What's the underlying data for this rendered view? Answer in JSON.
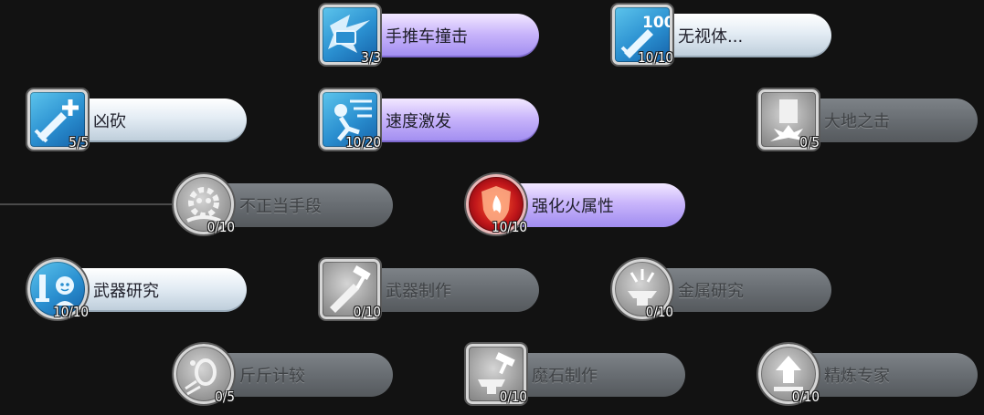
{
  "colors": {
    "background": "#121212",
    "purple_pill": "#b9a4f7",
    "light_pill": "#e3ecf4",
    "locked_pill": "#686d72",
    "icon_blue": "#2a8fd0"
  },
  "skills": [
    {
      "name": "手推车撞击",
      "level": "3/3",
      "state": "purple",
      "shape": "square",
      "icon": "cart-crash-icon"
    },
    {
      "name": "无视体...",
      "level": "10/10",
      "state": "light",
      "shape": "square",
      "icon": "sword-100-icon"
    },
    {
      "name": "凶砍",
      "level": "5/5",
      "state": "light",
      "shape": "square",
      "icon": "sword-plus-icon"
    },
    {
      "name": "速度激发",
      "level": "10/20",
      "state": "purple",
      "shape": "square",
      "icon": "speed-runner-icon"
    },
    {
      "name": "大地之击",
      "level": "0/5",
      "state": "gray",
      "shape": "square",
      "icon": "ground-strike-icon"
    },
    {
      "name": "不正当手段",
      "level": "0/10",
      "state": "gray",
      "shape": "circle",
      "icon": "trick-gear-icon"
    },
    {
      "name": "强化火属性",
      "level": "10/10",
      "state": "fire",
      "shape": "circle",
      "icon": "fire-shield-icon"
    },
    {
      "name": "武器研究",
      "level": "10/10",
      "state": "light",
      "shape": "circle",
      "icon": "weapon-study-icon"
    },
    {
      "name": "武器制作",
      "level": "0/10",
      "state": "gray",
      "shape": "square",
      "icon": "weapon-craft-icon"
    },
    {
      "name": "金属研究",
      "level": "0/10",
      "state": "gray",
      "shape": "circle",
      "icon": "metal-study-icon"
    },
    {
      "name": "斤斤计较",
      "level": "0/5",
      "state": "gray",
      "shape": "circle",
      "icon": "haggle-icon"
    },
    {
      "name": "魔石制作",
      "level": "0/10",
      "state": "gray",
      "shape": "square",
      "icon": "magic-stone-icon"
    },
    {
      "name": "精炼专家",
      "level": "0/10",
      "state": "gray",
      "shape": "circle",
      "icon": "refine-arrow-icon"
    }
  ]
}
